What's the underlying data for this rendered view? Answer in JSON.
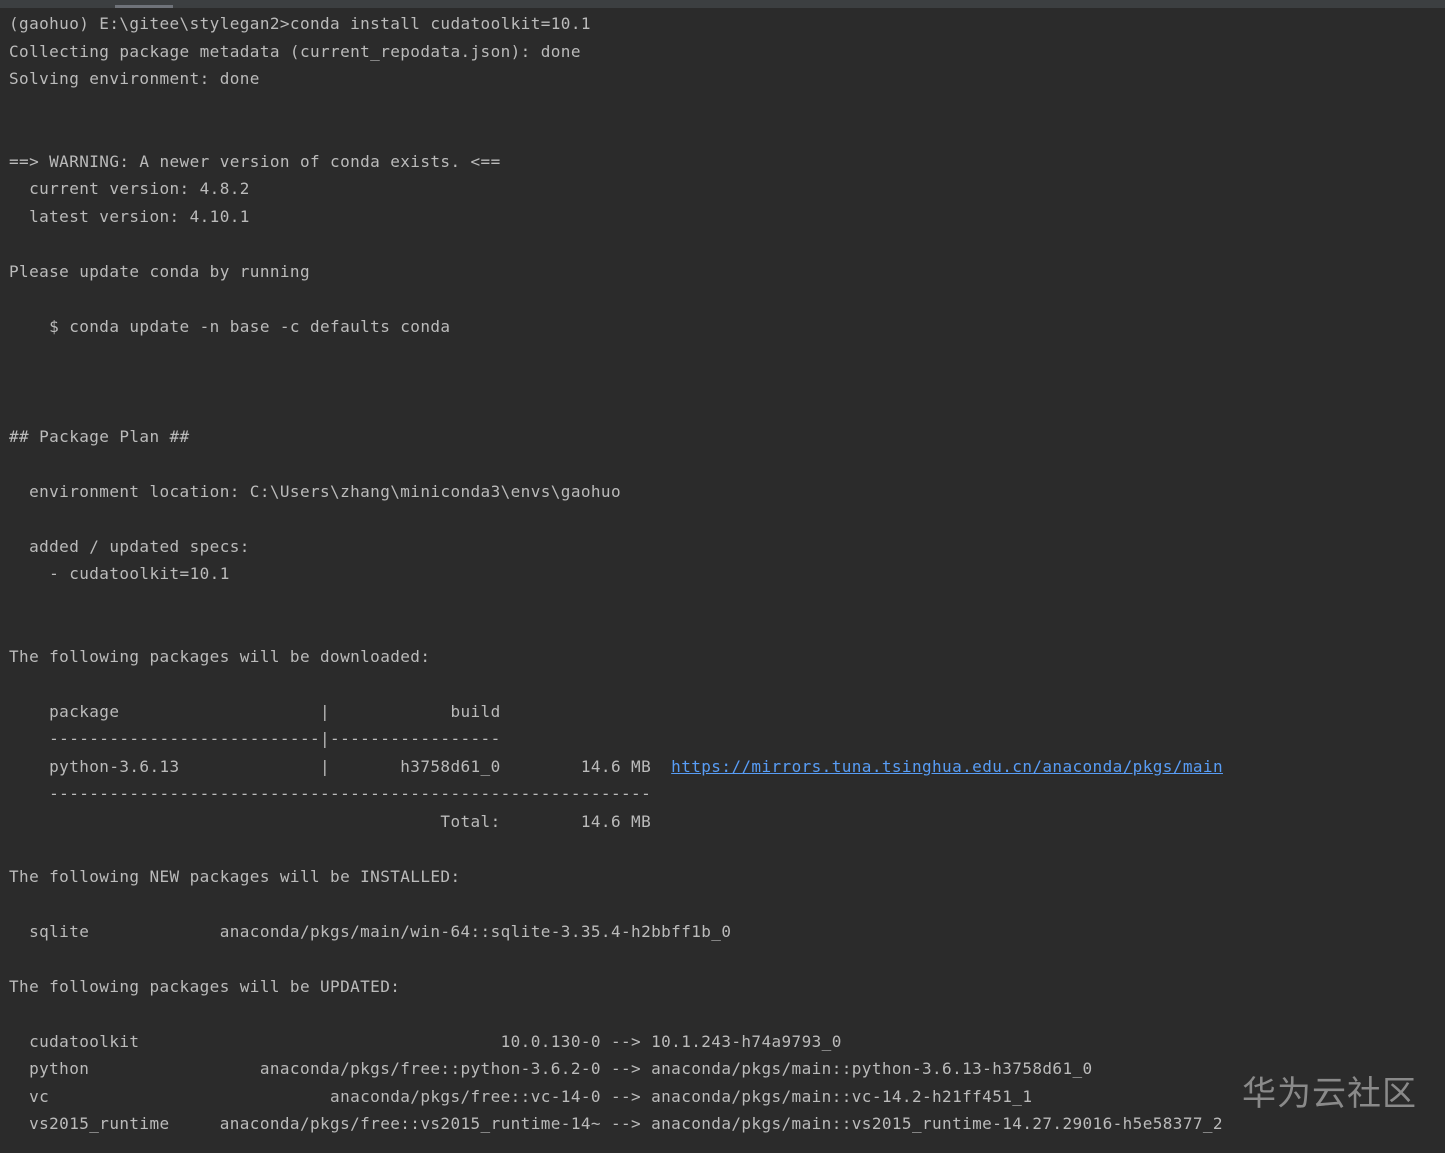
{
  "terminal": {
    "lines": [
      "(gaohuo) E:\\gitee\\stylegan2>conda install cudatoolkit=10.1",
      "Collecting package metadata (current_repodata.json): done",
      "Solving environment: done",
      "",
      "",
      "==> WARNING: A newer version of conda exists. <==",
      "  current version: 4.8.2",
      "  latest version: 4.10.1",
      "",
      "Please update conda by running",
      "",
      "    $ conda update -n base -c defaults conda",
      "",
      "",
      "",
      "## Package Plan ##",
      "",
      "  environment location: C:\\Users\\zhang\\miniconda3\\envs\\gaohuo",
      "",
      "  added / updated specs:",
      "    - cudatoolkit=10.1",
      "",
      "",
      "The following packages will be downloaded:",
      "",
      "    package                    |            build",
      "    ---------------------------|-----------------",
      "    python-3.6.13              |       h3758d61_0        14.6 MB  ",
      "    ------------------------------------------------------------",
      "                                           Total:        14.6 MB",
      "",
      "The following NEW packages will be INSTALLED:",
      "",
      "  sqlite             anaconda/pkgs/main/win-64::sqlite-3.35.4-h2bbff1b_0",
      "",
      "The following packages will be UPDATED:",
      "",
      "  cudatoolkit                                    10.0.130-0 --> 10.1.243-h74a9793_0",
      "  python                 anaconda/pkgs/free::python-3.6.2-0 --> anaconda/pkgs/main::python-3.6.13-h3758d61_0",
      "  vc                            anaconda/pkgs/free::vc-14-0 --> anaconda/pkgs/main::vc-14.2-h21ff451_1",
      "  vs2015_runtime     anaconda/pkgs/free::vs2015_runtime-14~ --> anaconda/pkgs/main::vs2015_runtime-14.27.29016-h5e58377_2"
    ],
    "link_text": "https://mirrors.tuna.tsinghua.edu.cn/anaconda/pkgs/main"
  },
  "watermark": "华为云社区"
}
